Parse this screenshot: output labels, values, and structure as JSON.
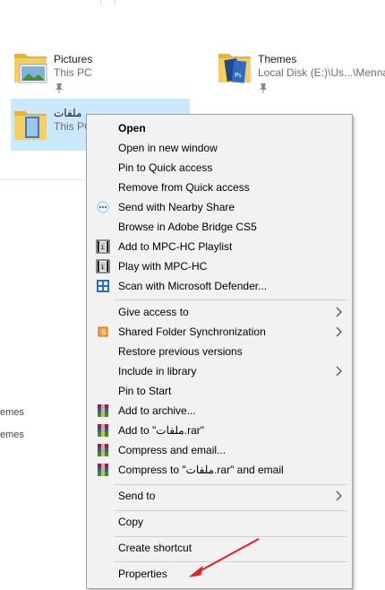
{
  "quick_access": {
    "pictures": {
      "name": "Pictures",
      "location": "This PC"
    },
    "themes": {
      "name": "Themes",
      "location": "Local Disk (E:)\\Us...\\Menna"
    },
    "folder": {
      "name": "ملفات",
      "location": "This PC"
    }
  },
  "recent": {
    "item1": "emes",
    "item2": "emes"
  },
  "context_menu": {
    "open": "Open",
    "open_new_window": "Open in new window",
    "pin_quick_access": "Pin to Quick access",
    "remove_quick_access": "Remove from Quick access",
    "nearby_share": "Send with Nearby Share",
    "adobe_bridge": "Browse in Adobe Bridge CS5",
    "mpc_playlist": "Add to MPC-HC Playlist",
    "mpc_play": "Play with MPC-HC",
    "defender": "Scan with Microsoft Defender...",
    "give_access": "Give access to",
    "shared_folder_sync": "Shared Folder Synchronization",
    "restore_versions": "Restore previous versions",
    "include_library": "Include in library",
    "pin_start": "Pin to Start",
    "add_archive": "Add to archive...",
    "add_rar": "Add to \"ملفات.rar\"",
    "compress_email": "Compress and email...",
    "compress_rar_email": "Compress to \"ملفات.rar\" and email",
    "send_to": "Send to",
    "copy": "Copy",
    "create_shortcut": "Create shortcut",
    "properties": "Properties"
  },
  "colors": {
    "selection": "#cce8ff",
    "menu_bg": "#f2f2f2",
    "annotation_arrow": "#e0222a"
  }
}
